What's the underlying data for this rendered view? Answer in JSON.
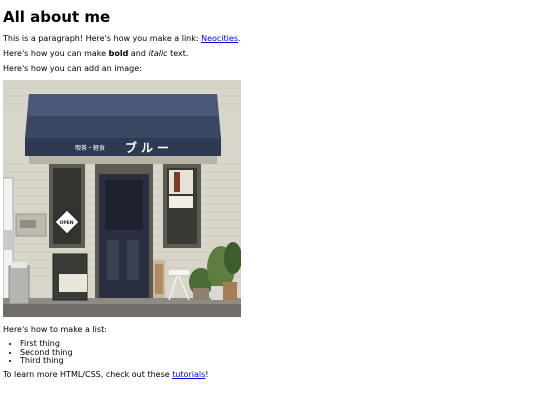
{
  "heading": "All about me",
  "para_link": {
    "before": "This is a paragraph! Here's how you make a link: ",
    "link_text": "Neocities",
    "after": "."
  },
  "para_format": {
    "before": "Here's how you can make ",
    "bold_text": "bold",
    "middle": " and ",
    "italic_text": "italic",
    "after": " text."
  },
  "para_image": "Here's how you can add an image:",
  "image": {
    "sign_small": "喫茶・軽食",
    "sign_large": "ブルー",
    "door_sign": "OPEN"
  },
  "para_list": "Here's how to make a list:",
  "list_items": [
    "First thing",
    "Second thing",
    "Third thing"
  ],
  "para_learn": {
    "before": "To learn more HTML/CSS, check out these ",
    "link_text": "tutorials",
    "after": "!"
  },
  "colors": {
    "link": "#0000ee",
    "awning": "#3a4763",
    "wall": "#d9d6cb",
    "door": "#2a3040"
  }
}
